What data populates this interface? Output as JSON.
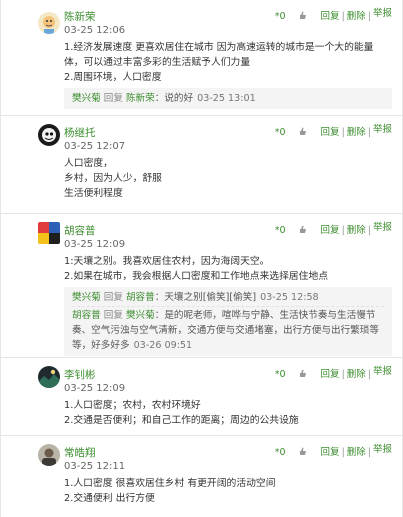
{
  "comments": [
    {
      "author": "陈新荣",
      "time": "03-25 12:06",
      "votes": "*0",
      "actions": {
        "reply": "回复",
        "sep": "|",
        "delete": "删除",
        "report": "举报"
      },
      "lines": [
        "1.经济发展速度 更喜欢居住在城市 因为高速运转的城市是一个大的能量体，可以通过丰富多彩的生活赋予人们力量",
        "2.周围环境，人口密度"
      ],
      "replies": [
        {
          "author": "樊兴菊",
          "verb": "回复",
          "target": "陈新荣",
          "text": "：说的好",
          "time": "03-25 13:01"
        }
      ]
    },
    {
      "author": "杨继托",
      "time": "03-25 12:07",
      "votes": "*0",
      "actions": {
        "reply": "回复",
        "sep": "|",
        "delete": "删除",
        "report": "举报"
      },
      "lines": [
        "人口密度，",
        "乡村，因为人少，舒服",
        "生活便利程度"
      ],
      "replies": []
    },
    {
      "author": "胡容普",
      "time": "03-25 12:09",
      "votes": "*0",
      "actions": {
        "reply": "回复",
        "sep": "|",
        "delete": "删除",
        "report": "举报"
      },
      "lines": [
        "1:天壤之别。我喜欢居住农村，因为海阔天空。",
        "2.如果在城市，我会根据人口密度和工作地点来选择居住地点"
      ],
      "replies": [
        {
          "author": "樊兴菊",
          "verb": "回复",
          "target": "胡容普",
          "text": "：天壤之别[偷笑][偷笑]",
          "time": "03-25 12:58"
        },
        {
          "author": "胡容普",
          "verb": "回复",
          "target": "樊兴菊",
          "text": "：是的呢老师，喧哗与宁静、生活快节奏与生活慢节奏、空气污浊与空气清新，交通方便与交通堵塞，出行方便与出行繁琐等等，好多好多",
          "time": "03-26 09:51"
        }
      ]
    },
    {
      "author": "李钊彬",
      "time": "03-25 12:09",
      "votes": "*0",
      "actions": {
        "reply": "回复",
        "sep": "|",
        "delete": "删除",
        "report": "举报"
      },
      "lines": [
        "1.人口密度；农村，农村环境好",
        "2.交通是否便利；和自己工作的距离；周边的公共设施"
      ],
      "replies": []
    },
    {
      "author": "常皓翔",
      "time": "03-25 12:11",
      "votes": "*0",
      "actions": {
        "reply": "回复",
        "sep": "|",
        "delete": "删除",
        "report": "举报"
      },
      "lines": [
        "1.人口密度 很喜欢居住乡村 有更开阔的活动空间",
        "2.交通便利 出行方便"
      ],
      "replies": []
    }
  ],
  "colors": {
    "accent": "#3c8d2f",
    "reply_bg": "#f4f4f4"
  },
  "icons": [
    "avatar-cartoon",
    "avatar-dark-bird",
    "avatar-colorful-blocks",
    "avatar-dark-landscape",
    "avatar-photo",
    "thumbs-up-icon"
  ]
}
